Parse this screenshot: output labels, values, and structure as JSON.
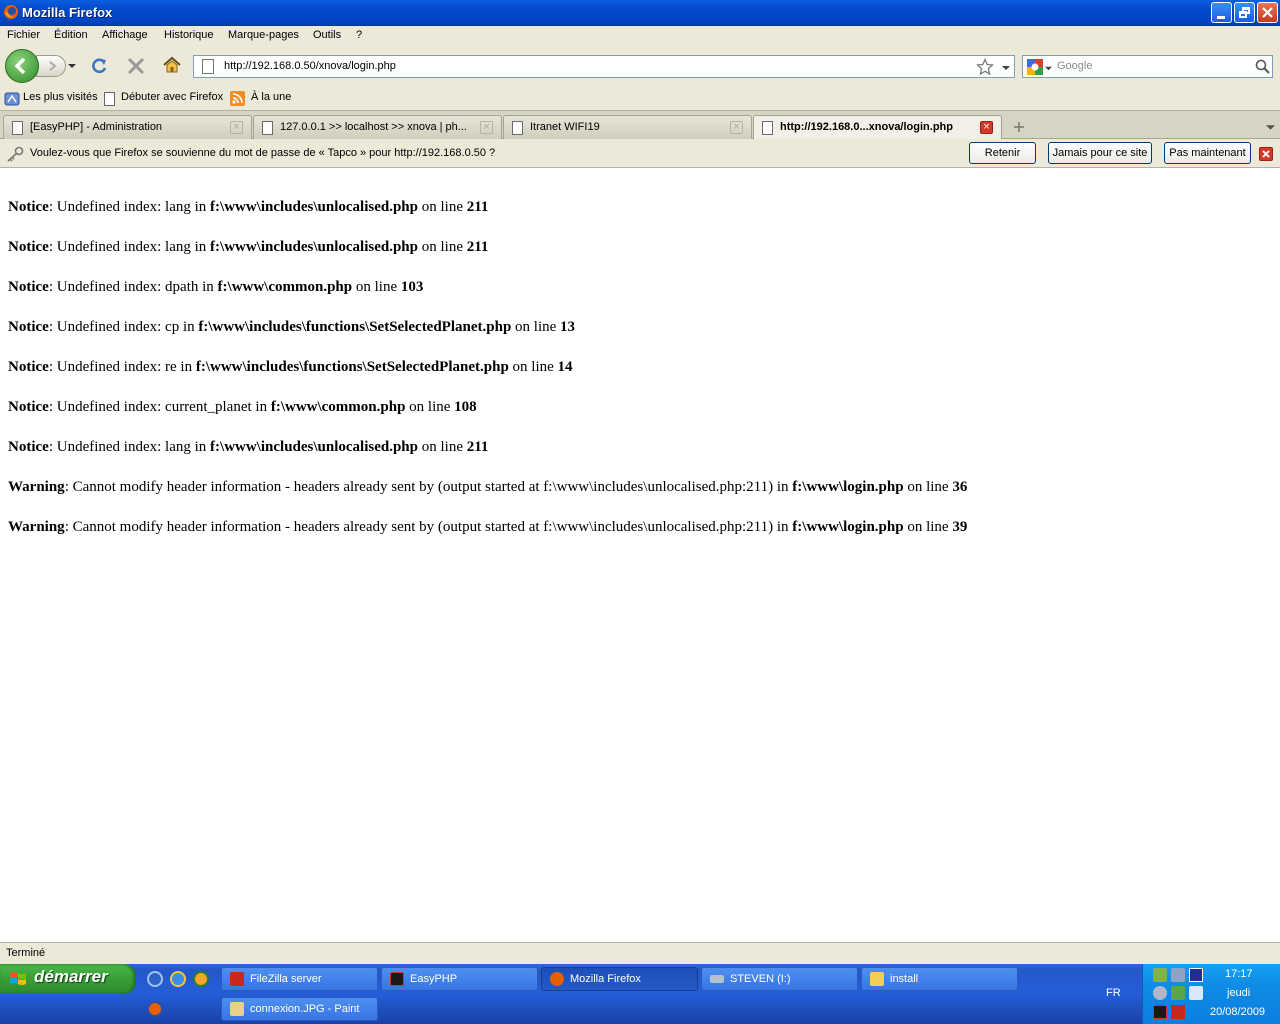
{
  "window": {
    "title": "Mozilla Firefox"
  },
  "menu": [
    "Fichier",
    "Édition",
    "Affichage",
    "Historique",
    "Marque-pages",
    "Outils",
    "?"
  ],
  "address": {
    "url": "http://192.168.0.50/xnova/login.php"
  },
  "search": {
    "placeholder": "Google"
  },
  "bookmarks": [
    "Les plus visités",
    "Débuter avec Firefox",
    "À la une"
  ],
  "tabs": [
    {
      "label": "[EasyPHP] - Administration",
      "active": false
    },
    {
      "label": "127.0.0.1 >> localhost >> xnova | ph...",
      "active": false
    },
    {
      "label": "Itranet WIFI19",
      "active": false
    },
    {
      "label": "http://192.168.0...xnova/login.php",
      "active": true
    }
  ],
  "notification": {
    "message": "Voulez-vous que Firefox se souvienne du mot de passe de « Tapco » pour http://192.168.0.50 ?",
    "buttons": [
      "Retenir",
      "Jamais pour ce site",
      "Pas maintenant"
    ]
  },
  "page_lines": [
    {
      "kind": "Notice",
      "parts": [
        ": Undefined index: lang in ",
        "f:\\www\\includes\\unlocalised.php",
        " on line ",
        "211"
      ]
    },
    {
      "kind": "Notice",
      "parts": [
        ": Undefined index: lang in ",
        "f:\\www\\includes\\unlocalised.php",
        " on line ",
        "211"
      ]
    },
    {
      "kind": "Notice",
      "parts": [
        ": Undefined index: dpath in ",
        "f:\\www\\common.php",
        " on line ",
        "103"
      ]
    },
    {
      "kind": "Notice",
      "parts": [
        ": Undefined index: cp in ",
        "f:\\www\\includes\\functions\\SetSelectedPlanet.php",
        " on line ",
        "13"
      ]
    },
    {
      "kind": "Notice",
      "parts": [
        ": Undefined index: re in ",
        "f:\\www\\includes\\functions\\SetSelectedPlanet.php",
        " on line ",
        "14"
      ]
    },
    {
      "kind": "Notice",
      "parts": [
        ": Undefined index: current_planet in ",
        "f:\\www\\common.php",
        " on line ",
        "108"
      ]
    },
    {
      "kind": "Notice",
      "parts": [
        ": Undefined index: lang in ",
        "f:\\www\\includes\\unlocalised.php",
        " on line ",
        "211"
      ]
    },
    {
      "kind": "Warning",
      "parts": [
        ": Cannot modify header information - headers already sent by (output started at f:\\www\\includes\\unlocalised.php:211) in ",
        "f:\\www\\login.php",
        " on line ",
        "36"
      ]
    },
    {
      "kind": "Warning",
      "parts": [
        ": Cannot modify header information - headers already sent by (output started at f:\\www\\includes\\unlocalised.php:211) in ",
        "f:\\www\\login.php",
        " on line ",
        "39"
      ]
    }
  ],
  "status": {
    "text": "Terminé"
  },
  "taskbar": {
    "start_label": "démarrer",
    "tasks": [
      {
        "label": "FileZilla server"
      },
      {
        "label": "EasyPHP"
      },
      {
        "label": "Mozilla Firefox"
      },
      {
        "label": "STEVEN (I:)"
      },
      {
        "label": "install"
      },
      {
        "label": "connexion.JPG - Paint"
      }
    ],
    "lang": "FR",
    "time": "17:17",
    "day": "jeudi",
    "date": "20/08/2009"
  },
  "colors": {
    "title_bar": "#0248c8",
    "chrome": "#ece9d8",
    "taskbar": "#245ed8",
    "start": "#379e36"
  }
}
